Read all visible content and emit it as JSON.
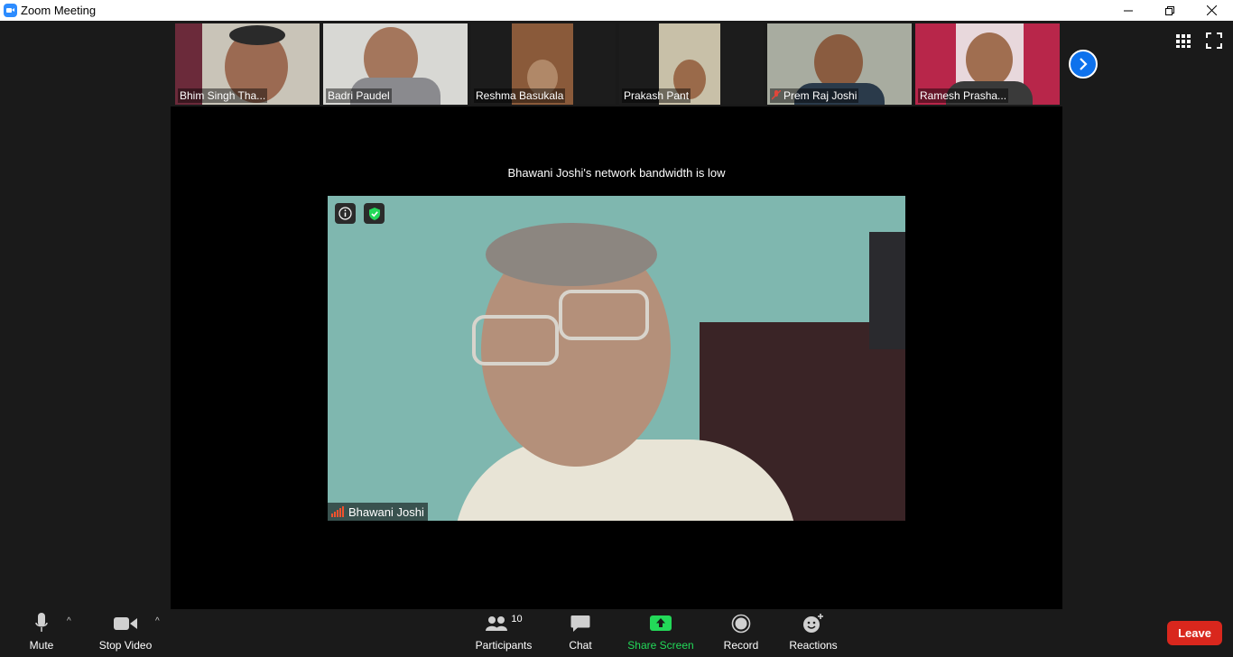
{
  "window": {
    "title": "Zoom Meeting",
    "controls": [
      "minimize",
      "restore",
      "close"
    ]
  },
  "participants_strip": [
    {
      "name": "Bhim Singh Tha...",
      "muted": false
    },
    {
      "name": "Badri Paudel",
      "muted": false
    },
    {
      "name": "Reshma Basukala",
      "muted": false
    },
    {
      "name": "Prakash Pant",
      "muted": false
    },
    {
      "name": "Prem Raj Joshi",
      "muted": true
    },
    {
      "name": "Ramesh Prasha...",
      "muted": false
    }
  ],
  "main": {
    "notice": "Bhawani Joshi's network bandwidth is low",
    "speaker_name": "Bhawani Joshi",
    "connection_status": "weak"
  },
  "toolbar": {
    "mute": "Mute",
    "stop_video": "Stop Video",
    "participants": "Participants",
    "participants_count": "10",
    "chat": "Chat",
    "share_screen": "Share Screen",
    "record": "Record",
    "reactions": "Reactions",
    "leave": "Leave"
  },
  "colors": {
    "accent": "#2d8cff",
    "share": "#23d959",
    "leave": "#d9271d",
    "background": "#1a1a1a"
  }
}
